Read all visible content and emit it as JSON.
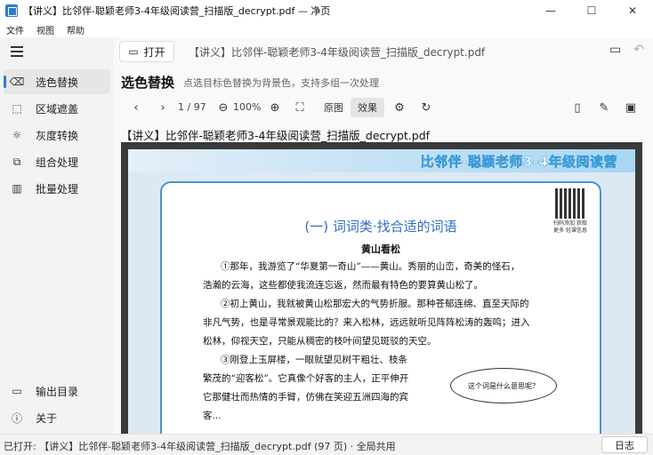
{
  "window": {
    "title": "【讲义】比邻伴-聪颖老师3-4年级阅读营_扫描版_decrypt.pdf — 净页",
    "minimize": "—",
    "maximize": "☐",
    "close": "✕"
  },
  "menu": [
    "文件",
    "视图",
    "帮助"
  ],
  "sidebar": {
    "items": [
      {
        "label": "选色替换",
        "icon": "eraser-icon",
        "glyph": "⌫"
      },
      {
        "label": "区域遮盖",
        "icon": "region-mask-icon",
        "glyph": "⬚"
      },
      {
        "label": "灰度转换",
        "icon": "sun-icon",
        "glyph": "☼"
      },
      {
        "label": "组合处理",
        "icon": "external-link-icon",
        "glyph": "⧉"
      },
      {
        "label": "批量处理",
        "icon": "books-icon",
        "glyph": "▥"
      }
    ],
    "bottom": [
      {
        "label": "输出目录",
        "icon": "folder-icon",
        "glyph": "▭"
      },
      {
        "label": "关于",
        "icon": "info-icon",
        "glyph": "ⓘ"
      }
    ]
  },
  "topbar": {
    "open_label": "打开",
    "filename": "【讲义】比邻伴-聪颖老师3-4年级阅读营_扫描版_decrypt.pdf"
  },
  "section": {
    "title": "选色替换",
    "desc": "点选目标色替换为背景色，支持多组一次处理"
  },
  "toolbar": {
    "page": "1 / 97",
    "zoom": "100%",
    "view_original": "原图",
    "view_effect": "效果"
  },
  "document": {
    "title": "【讲义】比邻伴-聪颖老师3-4年级阅读营_扫描版_decrypt.pdf",
    "banner": "比邻伴-聪颖老师3-4年级阅读营",
    "qr_caption": "扫码添加 获取更多 轻课信息",
    "lesson_title": "(一) 词词类·找合适的词语",
    "poem_title": "黄山看松",
    "paragraphs": [
      "①那年，我游览了“华夏第一奇山”——黄山。秀丽的山峦，奇美的怪石，",
      "浩瀚的云海，这些都使我流连忘返，然而最有特色的要算黄山松了。",
      "②初上黄山，我就被黄山松那宏大的气势折服。那种苍郁连绵、直至天际的",
      "非凡气势，也是寻常景观能比的？来入松林，远远就听见阵阵松涛的轰鸣；进入",
      "松林，仰视天空，只能从稠密的枝叶间望见斑驳的天空。",
      "③刚登上玉屏楼，一眼就望见树干粗壮、枝条",
      "繁茂的“迎客松”。它真像个好客的主人，正平伸开",
      "它那健壮而热情的手臂，仿佛在笑迎五洲四海的宾",
      "客..."
    ],
    "bubble": "这个词是什么意思呢？"
  },
  "status": {
    "text": "已打开: 【讲义】比邻伴-聪颖老师3-4年级阅读营_扫描版_decrypt.pdf  (97 页) · 全局共用",
    "log_label": "日志"
  }
}
